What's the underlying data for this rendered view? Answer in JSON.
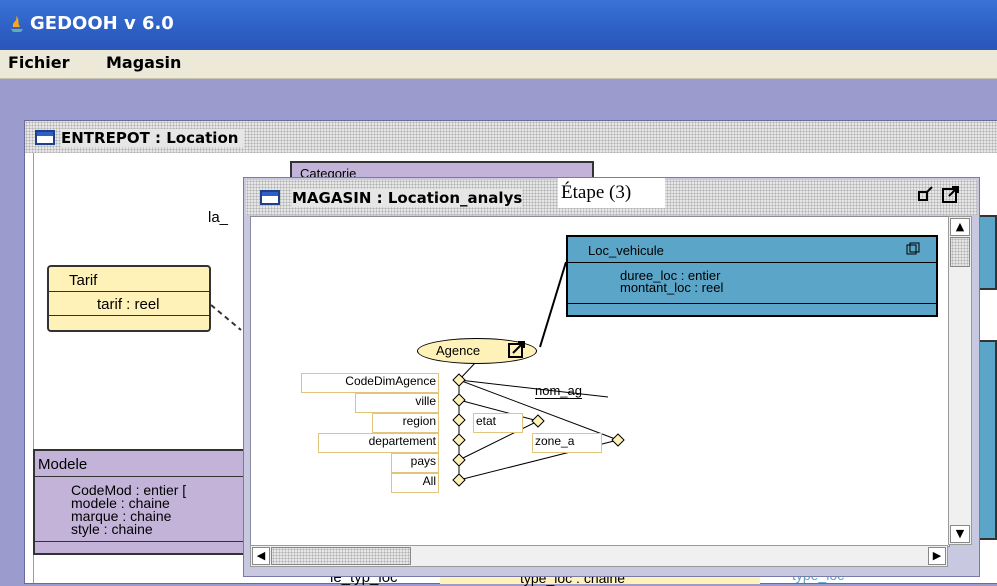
{
  "app": {
    "title": "GEDOOH v 6.0"
  },
  "menu": {
    "items": [
      "Fichier",
      "Magasin"
    ]
  },
  "entrepot": {
    "title": "ENTREPOT : Location",
    "tarif": {
      "name": "Tarif",
      "attr": "tarif : reel"
    },
    "categorie": {
      "name": "Categorie"
    },
    "la_label": "la_",
    "modele": {
      "name": "Modele",
      "attrs": [
        "CodeMod : entier  [",
        "modele : chaine",
        "marque : chaine",
        "style : chaine"
      ]
    },
    "bottom_texts": [
      "le_typ_loc",
      "type_loc : chaine",
      "type_loc"
    ]
  },
  "magasin": {
    "title": "MAGASIN : Location_analys",
    "loc_vehicule": {
      "name": "Loc_vehicule",
      "attrs": [
        "duree_loc : entier",
        "montant_loc : reel"
      ]
    },
    "agence": "Agence",
    "dims": [
      "CodeDimAgence",
      "ville",
      "region",
      "departement",
      "pays",
      "All"
    ],
    "attrs": [
      "nom_ag",
      "etat",
      "zone_a"
    ]
  },
  "annotation": "Étape (3)",
  "colors": {
    "class_yellow": "#fff2b8",
    "fact_blue": "#5aa5c8",
    "modele_purple": "#c3b3d9",
    "titlebar": "#2d5fc4",
    "desktop": "#9b9bcd"
  }
}
